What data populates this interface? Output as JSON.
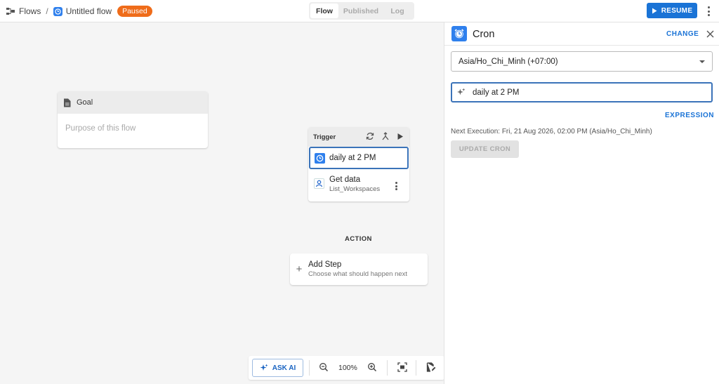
{
  "breadcrumb": {
    "root": "Flows",
    "separator": "/",
    "flow_name": "Untitled flow",
    "status": "Paused"
  },
  "tabs": [
    {
      "label": "Flow",
      "active": true
    },
    {
      "label": "Published",
      "active": false
    },
    {
      "label": "Log",
      "active": false
    }
  ],
  "header": {
    "resume_label": "RESUME"
  },
  "goal_card": {
    "title": "Goal",
    "placeholder": "Purpose of this flow"
  },
  "trigger_card": {
    "title": "Trigger",
    "trigger_item": "daily at 2 PM",
    "step": {
      "title": "Get data",
      "subtitle": "List_Workspaces"
    }
  },
  "action": {
    "section_label": "ACTION",
    "add_step_title": "Add Step",
    "add_step_subtitle": "Choose what should happen next"
  },
  "toolbar": {
    "ask_ai_label": "ASK AI",
    "zoom": "100%"
  },
  "panel": {
    "title": "Cron",
    "change_label": "CHANGE",
    "timezone": "Asia/Ho_Chi_Minh (+07:00)",
    "cron_value": "daily at 2 PM",
    "expression_label": "EXPRESSION",
    "next_execution": "Next Execution: Fri, 21 Aug 2026, 02:00 PM (Asia/Ho_Chi_Minh)",
    "update_label": "UPDATE CRON"
  },
  "colors": {
    "accent": "#1a73d6",
    "badge": "#ef6c1a",
    "selected_border": "#3b73b9"
  },
  "icons": [
    "flows-icon",
    "flow-clock-icon",
    "document-icon",
    "refresh-icon",
    "branch-icon",
    "play-icon",
    "clock-icon",
    "person-pin-icon",
    "kebab-icon",
    "plus-icon",
    "sparkle-icon",
    "zoom-out-icon",
    "zoom-in-icon",
    "fit-screen-icon",
    "edit-note-icon",
    "close-icon",
    "chevron-down-icon"
  ]
}
